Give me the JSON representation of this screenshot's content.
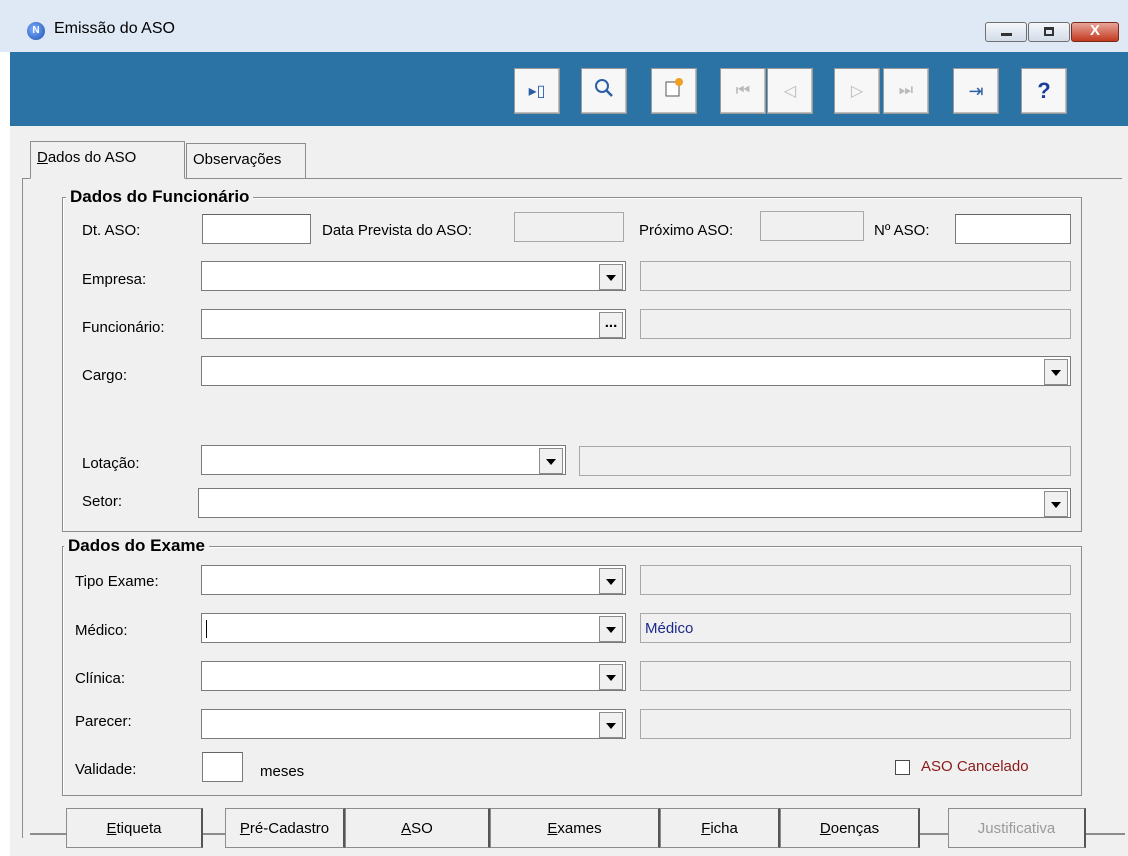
{
  "window": {
    "title": "Emissão do ASO"
  },
  "title_controls": {
    "close_glyph": "X"
  },
  "toolbar": {
    "buttons": [
      {
        "icon": "insert-record-icon",
        "glyph": "▸▯"
      },
      {
        "icon": "search-icon",
        "glyph": "🔍"
      },
      {
        "icon": "edit-record-icon",
        "glyph": "✎"
      },
      {
        "icon": "first-record-icon",
        "glyph": "⏮"
      },
      {
        "icon": "prior-record-icon",
        "glyph": "◁"
      },
      {
        "icon": "next-record-icon",
        "glyph": "▷"
      },
      {
        "icon": "last-record-icon",
        "glyph": "⏭"
      },
      {
        "icon": "exit-icon",
        "glyph": "⇥"
      },
      {
        "icon": "help-icon",
        "glyph": "?"
      }
    ]
  },
  "tabs": [
    {
      "label": "Dados do ASO"
    },
    {
      "label": "Observações"
    }
  ],
  "funcionario": {
    "title": "Dados do Funcionário",
    "dt_aso_label": "Dt. ASO:",
    "dt_aso_value": "",
    "data_prevista_label": "Data Prevista do ASO:",
    "data_prevista_value": "",
    "proximo_label": "Próximo ASO:",
    "proximo_value": "",
    "numero_label": "Nº ASO:",
    "numero_value": "",
    "empresa_label": "Empresa:",
    "empresa_value": "",
    "empresa_desc": "",
    "funcionario_label": "Funcionário:",
    "funcionario_value": "",
    "funcionario_desc": "",
    "cargo_label": "Cargo:",
    "cargo_value": "",
    "lotacao_label": "Lotação:",
    "lotacao_value": "",
    "lotacao_desc": "",
    "setor_label": "Setor:",
    "setor_value": ""
  },
  "exame": {
    "title": "Dados do Exame",
    "tipo_label": "Tipo Exame:",
    "tipo_value": "",
    "tipo_desc": "",
    "medico_label": "Médico:",
    "medico_value": "",
    "medico_desc": "Médico",
    "clinica_label": "Clínica:",
    "clinica_value": "",
    "clinica_desc": "",
    "parecer_label": "Parecer:",
    "parecer_value": "",
    "parecer_desc": "",
    "validade_label": "Validade:",
    "validade_value": "",
    "meses_label": "meses",
    "cancelado_label": "ASO Cancelado",
    "cancelado_checked": false
  },
  "bottom_buttons": [
    {
      "label": "Etiqueta",
      "u": "E",
      "rest": "tiqueta"
    },
    {
      "label": "Pré-Cadastro",
      "u": "P",
      "rest": "ré-Cadastro"
    },
    {
      "label": "ASO",
      "u": "A",
      "rest": "SO"
    },
    {
      "label": "Exames",
      "u": "E",
      "rest": "xames"
    },
    {
      "label": "Ficha",
      "u": "F",
      "rest": "icha"
    },
    {
      "label": "Doenças",
      "u": "D",
      "rest": "oenças"
    },
    {
      "label": "Justificativa",
      "u": "",
      "rest": "Justificativa"
    }
  ],
  "colors": {
    "toolbar": "#2b73a4",
    "titlebar": "#dfe9f5",
    "window": "#f0f0f0",
    "cancel_label": "#8b1a1a",
    "desc_text": "#1b2a8a"
  }
}
